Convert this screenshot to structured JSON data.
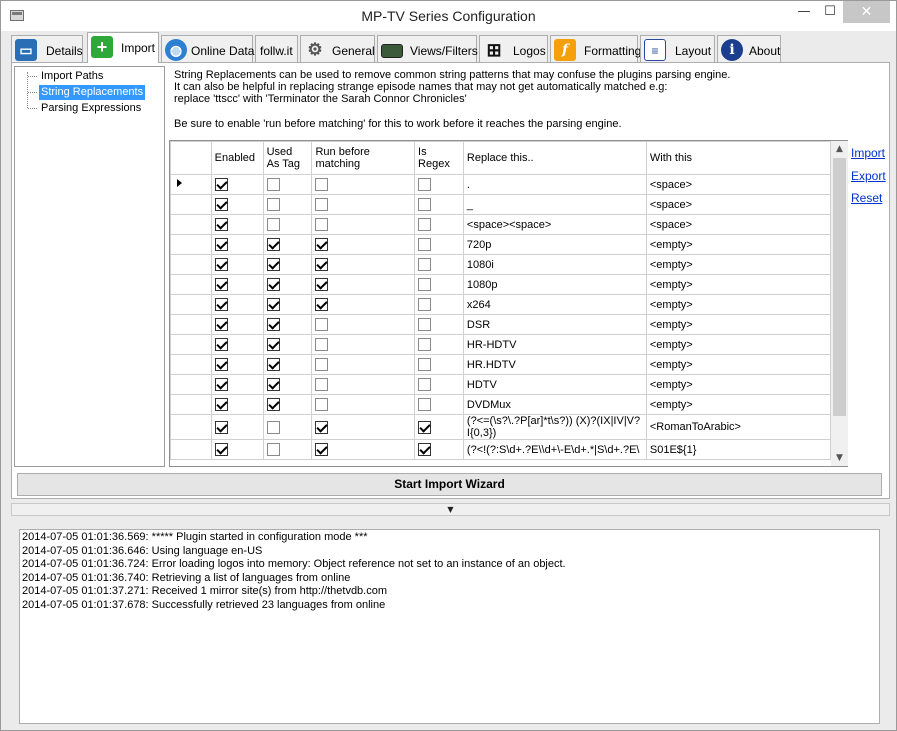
{
  "window": {
    "title": "MP-TV Series Configuration",
    "minimize_glyph": "—",
    "maximize_glyph": "☐",
    "close_glyph": "✕"
  },
  "tabs": [
    {
      "label": "Details",
      "icon": "monitor-icon"
    },
    {
      "label": "Import",
      "icon": "plus-icon",
      "active": true
    },
    {
      "label": "Online Data",
      "icon": "globe-icon"
    },
    {
      "label": "follw.it"
    },
    {
      "label": "General",
      "icon": "gear-icon"
    },
    {
      "label": "Views/Filters",
      "icon": "screen-icon"
    },
    {
      "label": "Logos",
      "icon": "grid-icon"
    },
    {
      "label": "Formatting",
      "icon": "f-icon"
    },
    {
      "label": "Layout",
      "icon": "layout-icon"
    },
    {
      "label": "About",
      "icon": "info-icon"
    }
  ],
  "tree": {
    "items": [
      "Import Paths",
      "String Replacements",
      "Parsing Expressions"
    ],
    "selected": "String Replacements"
  },
  "description": {
    "line1": "String Replacements can be used to remove common string patterns that may confuse the plugins parsing engine.",
    "line2": "It can also be helpful in replacing strange episode names that may not get automatically matched e.g:",
    "line3": "replace 'ttscc' with 'Terminator the Sarah Connor Chronicles'",
    "line4": "Be sure to enable 'run before matching' for this to work before it reaches the parsing engine."
  },
  "grid": {
    "columns": {
      "enabled": "Enabled",
      "used_as_tag_1": "Used",
      "used_as_tag_2": "As Tag",
      "run_before_1": "Run before",
      "run_before_2": "matching",
      "is_regex_1": "Is",
      "is_regex_2": "Regex",
      "replace": "Replace this..",
      "with": "With this"
    },
    "rows": [
      {
        "enabled": true,
        "tag": false,
        "before": false,
        "regex": false,
        "replace": ".",
        "with": "<space>",
        "current": true
      },
      {
        "enabled": true,
        "tag": false,
        "before": false,
        "regex": false,
        "replace": "_",
        "with": "<space>"
      },
      {
        "enabled": true,
        "tag": false,
        "before": false,
        "regex": false,
        "replace": "<space><space>",
        "with": "<space>"
      },
      {
        "enabled": true,
        "tag": true,
        "before": true,
        "regex": false,
        "replace": "720p",
        "with": "<empty>"
      },
      {
        "enabled": true,
        "tag": true,
        "before": true,
        "regex": false,
        "replace": "1080i",
        "with": "<empty>"
      },
      {
        "enabled": true,
        "tag": true,
        "before": true,
        "regex": false,
        "replace": "1080p",
        "with": "<empty>"
      },
      {
        "enabled": true,
        "tag": true,
        "before": true,
        "regex": false,
        "replace": "x264",
        "with": "<empty>"
      },
      {
        "enabled": true,
        "tag": true,
        "before": false,
        "regex": false,
        "replace": "DSR",
        "with": "<empty>"
      },
      {
        "enabled": true,
        "tag": true,
        "before": false,
        "regex": false,
        "replace": "HR-HDTV",
        "with": "<empty>"
      },
      {
        "enabled": true,
        "tag": true,
        "before": false,
        "regex": false,
        "replace": "HR.HDTV",
        "with": "<empty>"
      },
      {
        "enabled": true,
        "tag": true,
        "before": false,
        "regex": false,
        "replace": "HDTV",
        "with": "<empty>"
      },
      {
        "enabled": true,
        "tag": true,
        "before": false,
        "regex": false,
        "replace": "DVDMux",
        "with": "<empty>"
      },
      {
        "enabled": true,
        "tag": false,
        "before": true,
        "regex": true,
        "replace": "(?<=(\\s?\\.?P[ar]*t\\s?)) (X)?(IX|IV|V?I{0,3})",
        "with": "<RomanToArabic>",
        "tall": true
      },
      {
        "enabled": true,
        "tag": false,
        "before": true,
        "regex": true,
        "replace": "(?<!(?:S\\d+.?E\\\\d+\\-E\\d+.*|S\\d+.?E\\",
        "with": "S01E${1}"
      }
    ]
  },
  "side_links": {
    "import": "Import",
    "export": "Export",
    "reset": "Reset"
  },
  "wizard_button": "Start Import Wizard",
  "splitter_glyph": "▼",
  "log": [
    "2014-07-05 01:01:36.569: ***** Plugin started in configuration mode ***",
    "2014-07-05 01:01:36.646: Using language en-US",
    "2014-07-05 01:01:36.724: Error loading logos into memory: Object reference not set to an instance of an object.",
    "2014-07-05 01:01:36.740: Retrieving a list of languages from online",
    "2014-07-05 01:01:37.271: Received 1 mirror site(s) from http://thetvdb.com",
    "2014-07-05 01:01:37.678: Successfully retrieved 23 languages from online"
  ]
}
